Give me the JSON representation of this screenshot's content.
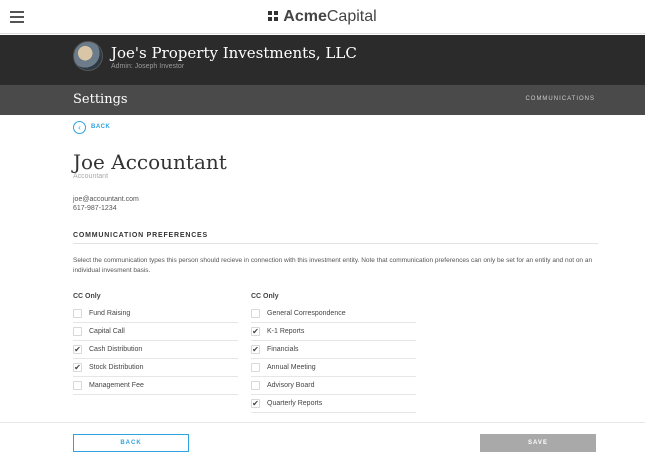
{
  "app": {
    "brand_bold": "Acme",
    "brand_light": "Capital"
  },
  "entity": {
    "name": "Joe's Property Investments, LLC",
    "admin": "Admin: Joseph Investor"
  },
  "settings": {
    "title": "Settings",
    "tab": "COMMUNICATIONS"
  },
  "back_link": "BACK",
  "person": {
    "name": "Joe Accountant",
    "role": "Accountant",
    "email": "joe@accountant.com",
    "phone": "617-987-1234"
  },
  "preferences": {
    "title": "COMMUNICATION PREFERENCES",
    "description": "Select the communication types this person should recieve in connection with this investment entity. Note that communication preferences can only be set for an entity and not on an individual invesment basis.",
    "left": {
      "header": "CC Only",
      "items": [
        {
          "label": "Fund Raising",
          "checked": false
        },
        {
          "label": "Capital Call",
          "checked": false
        },
        {
          "label": "Cash Distribution",
          "checked": true
        },
        {
          "label": "Stock Distribution",
          "checked": true
        },
        {
          "label": "Management Fee",
          "checked": false
        }
      ]
    },
    "right": {
      "header": "CC Only",
      "items": [
        {
          "label": "General Correspondence",
          "checked": false
        },
        {
          "label": "K-1 Reports",
          "checked": true
        },
        {
          "label": "Financials",
          "checked": true
        },
        {
          "label": "Annual Meeting",
          "checked": false
        },
        {
          "label": "Advisory Board",
          "checked": false
        },
        {
          "label": "Quarterly Reports",
          "checked": true
        }
      ]
    }
  },
  "footer": {
    "back_label": "BACK",
    "save_label": "SAVE"
  },
  "colors": {
    "accent": "#2ea3e0",
    "header_dark": "#2b2b2b",
    "settings_bar": "#4a4a4a",
    "save_disabled": "#a9a9a9"
  },
  "icons": {
    "menu": "hamburger-menu-icon",
    "back": "chevron-left-icon",
    "check": "check-icon"
  }
}
